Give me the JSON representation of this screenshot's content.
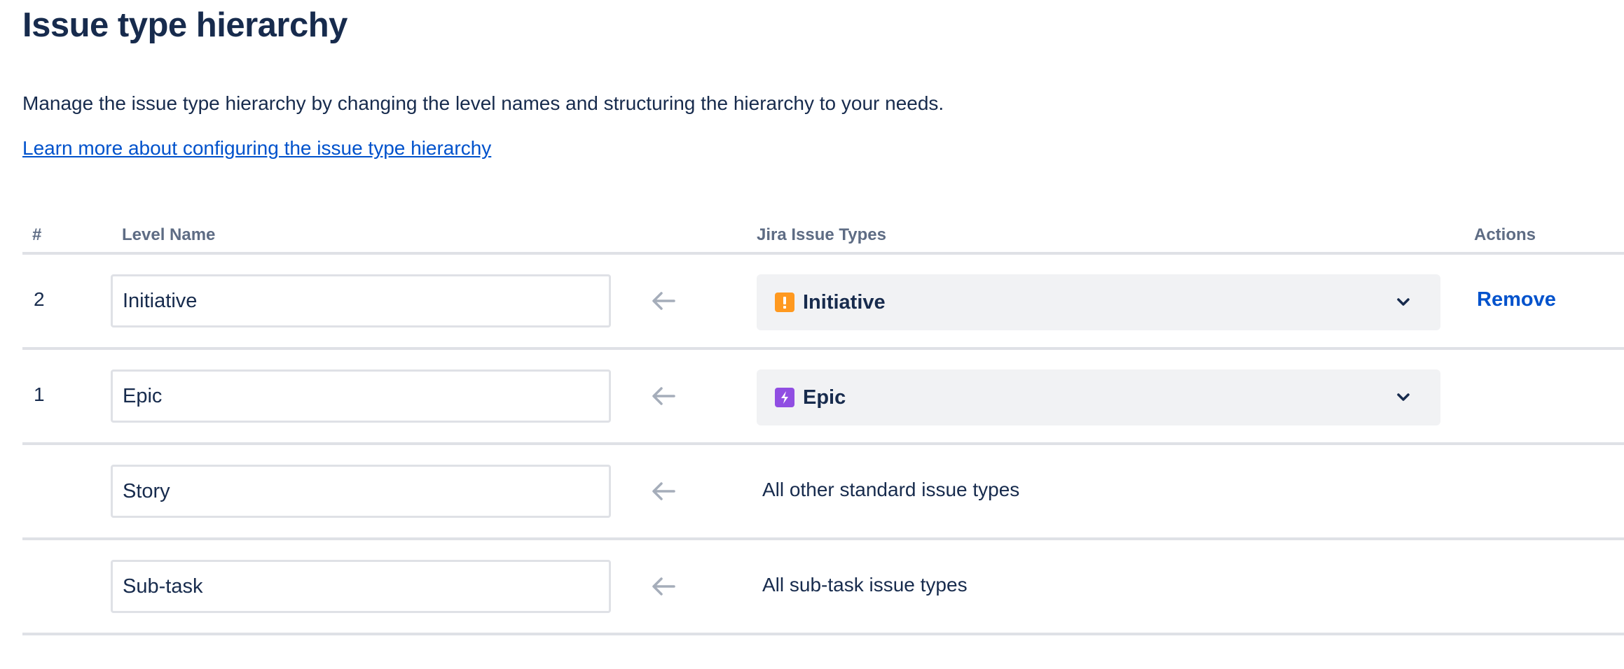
{
  "page": {
    "title": "Issue type hierarchy",
    "description": "Manage the issue type hierarchy by changing the level names and structuring the hierarchy to your needs.",
    "learn_link": "Learn more about configuring the issue type hierarchy"
  },
  "table": {
    "headers": {
      "num": "#",
      "level_name": "Level Name",
      "issue_types": "Jira Issue Types",
      "actions": "Actions"
    },
    "rows": [
      {
        "num": "2",
        "level_name": "Initiative",
        "issue_type": {
          "label": "Initiative",
          "icon": "initiative-icon",
          "color": "#ff991f"
        },
        "action": "Remove"
      },
      {
        "num": "1",
        "level_name": "Epic",
        "issue_type": {
          "label": "Epic",
          "icon": "epic-icon",
          "color": "#904ee2"
        }
      },
      {
        "level_name": "Story",
        "issue_type_text": "All other standard issue types"
      },
      {
        "level_name": "Sub-task",
        "issue_type_text": "All sub-task issue types"
      }
    ]
  },
  "colors": {
    "link": "#0052cc",
    "text": "#172b4d",
    "header_text": "#5e6c84",
    "border": "#dfe1e6",
    "select_bg": "#f1f2f4"
  }
}
